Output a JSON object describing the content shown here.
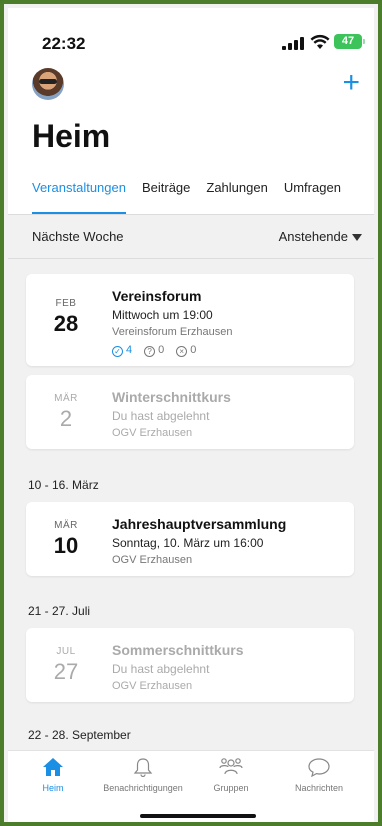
{
  "status": {
    "time": "22:32",
    "battery": "47"
  },
  "header": {
    "title": "Heim",
    "add_label": "+"
  },
  "tabs": [
    {
      "label": "Veranstaltungen",
      "active": true
    },
    {
      "label": "Beiträge",
      "active": false
    },
    {
      "label": "Zahlungen",
      "active": false
    },
    {
      "label": "Umfragen",
      "active": false
    }
  ],
  "filter": {
    "left": "Nächste Woche",
    "right": "Anstehende"
  },
  "events": [
    {
      "month": "FEB",
      "day": "28",
      "title": "Vereinsforum",
      "subtitle": "Mittwoch um 19:00",
      "location": "Vereinsforum Erzhausen",
      "rsvp": {
        "accepted": "4",
        "maybe": "0",
        "declined": "0"
      }
    },
    {
      "month": "MÄR",
      "day": "2",
      "title": "Winterschnittkurs",
      "subtitle": "Du hast abgelehnt",
      "location": "OGV Erzhausen"
    },
    {
      "month": "MÄR",
      "day": "10",
      "title": "Jahreshauptversammlung",
      "subtitle": "Sonntag, 10. März um 16:00",
      "location": "OGV Erzhausen"
    },
    {
      "month": "JUL",
      "day": "27",
      "title": "Sommerschnittkurs",
      "subtitle": "Du hast abgelehnt",
      "location": "OGV Erzhausen"
    }
  ],
  "sections": [
    "10 - 16. März",
    "21 - 27. Juli",
    "22 - 28. September"
  ],
  "nav": [
    {
      "label": "Heim",
      "icon": "home-icon"
    },
    {
      "label": "Benachrichtigungen",
      "icon": "bell-icon"
    },
    {
      "label": "Gruppen",
      "icon": "groups-icon"
    },
    {
      "label": "Nachrichten",
      "icon": "chat-bubble-icon"
    }
  ],
  "colors": {
    "accent": "#1b8fe3",
    "battery": "#3cc45a",
    "frame": "#4b7d2b"
  }
}
